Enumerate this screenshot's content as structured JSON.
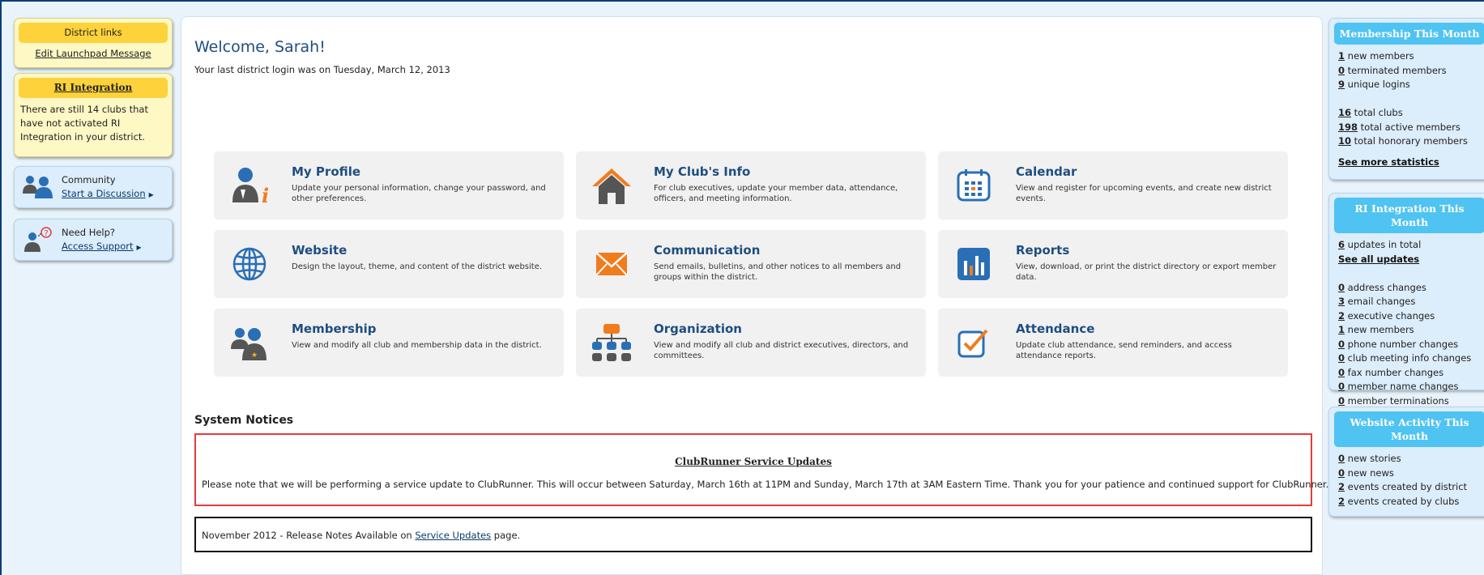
{
  "left": {
    "district_links_title": "District links",
    "edit_launchpad": "Edit Launchpad Message",
    "ri_integration_title": "RI Integration",
    "ri_integration_text": "There are still 14 clubs that have not activated RI Integration in your district.",
    "community_label": "Community",
    "community_link": "Start a Discussion",
    "help_label": "Need Help?",
    "help_link": "Access Support"
  },
  "main": {
    "welcome": "Welcome, Sarah!",
    "last_login": "Your last district login was on Tuesday, March 12, 2013",
    "tiles": [
      {
        "title": "My Profile",
        "desc": "Update your personal information, change your password, and other preferences.",
        "icon": "user-profile-icon"
      },
      {
        "title": "My Club's Info",
        "desc": "For club executives, update your member data, attendance, officers, and meeting information.",
        "icon": "house-icon"
      },
      {
        "title": "Calendar",
        "desc": "View and register for upcoming events, and create new district events.",
        "icon": "calendar-icon"
      },
      {
        "title": "Website",
        "desc": "Design the layout, theme, and content of the district website.",
        "icon": "globe-icon"
      },
      {
        "title": "Communication",
        "desc": "Send emails, bulletins, and other notices to all members and groups within the district.",
        "icon": "envelope-icon"
      },
      {
        "title": "Reports",
        "desc": "View, download, or print the district directory or export member data.",
        "icon": "bar-chart-icon"
      },
      {
        "title": "Membership",
        "desc": "View and modify all club and membership data in the district.",
        "icon": "members-icon"
      },
      {
        "title": "Organization",
        "desc": "View and modify all club and district executives, directors, and committees.",
        "icon": "org-chart-icon"
      },
      {
        "title": "Attendance",
        "desc": "Update club attendance, send reminders, and access attendance reports.",
        "icon": "checkbox-icon"
      }
    ],
    "system_notices_title": "System Notices",
    "notice_title": "ClubRunner Service Updates",
    "notice_body": "Please note that we will be performing a service update to ClubRunner. This will occur between Saturday, March 16th at 11PM and Sunday, March 17th at 3AM Eastern Time. Thank you for your patience and continued support for ClubRunner.",
    "release_prefix": "November 2012 - Release Notes Available on ",
    "release_link": "Service Updates",
    "release_suffix": " page."
  },
  "right": {
    "membership": {
      "title": "Membership This Month",
      "rows": [
        {
          "n": "1",
          "t": " new members"
        },
        {
          "n": "0",
          "t": " terminated members"
        },
        {
          "n": "9",
          "t": " unique logins"
        }
      ],
      "rows2": [
        {
          "n": "16",
          "t": " total clubs"
        },
        {
          "n": "198",
          "t": " total active members"
        },
        {
          "n": "10",
          "t": " total honorary members"
        }
      ],
      "see_more": "See more statistics"
    },
    "ri": {
      "title": "RI Integration This Month",
      "total_n": "6",
      "total_t": " updates in total",
      "see_all": "See all updates",
      "rows": [
        {
          "n": "0",
          "t": " address changes"
        },
        {
          "n": "3",
          "t": " email changes"
        },
        {
          "n": "2",
          "t": " executive changes"
        },
        {
          "n": "1",
          "t": " new members"
        },
        {
          "n": "0",
          "t": " phone number changes"
        },
        {
          "n": "0",
          "t": " club meeting info changes"
        },
        {
          "n": "0",
          "t": " fax number changes"
        },
        {
          "n": "0",
          "t": " member name changes"
        },
        {
          "n": "0",
          "t": " member terminations"
        }
      ]
    },
    "website": {
      "title": "Website Activity This Month",
      "rows": [
        {
          "n": "0",
          "t": " new stories"
        },
        {
          "n": "0",
          "t": " new news"
        },
        {
          "n": "2",
          "t": " events created by district"
        },
        {
          "n": "2",
          "t": " events created by clubs"
        }
      ]
    }
  },
  "colors": {
    "accent_yellow": "#fdd23a",
    "accent_blue": "#4fc3f2",
    "title_blue": "#1e4e80",
    "notice_red": "#e53a3a"
  }
}
